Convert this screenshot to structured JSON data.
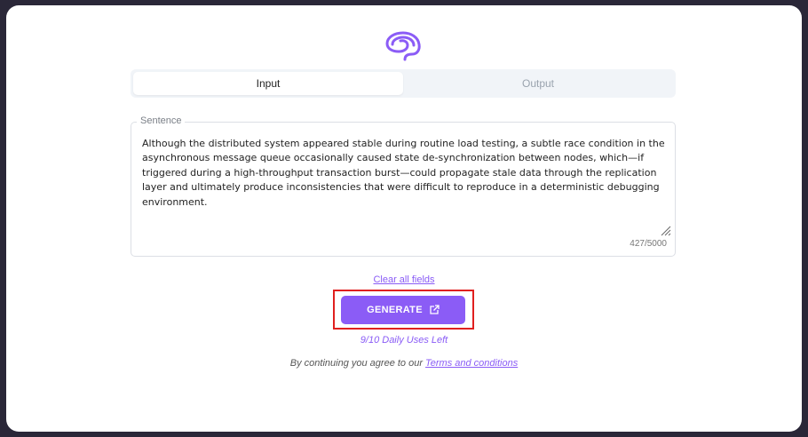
{
  "tabs": {
    "input_label": "Input",
    "output_label": "Output",
    "active": "Input"
  },
  "sentence_field": {
    "label": "Sentence",
    "value": "Although the distributed system appeared stable during routine load testing, a subtle race condition in the asynchronous message queue occasionally caused state de-synchronization between nodes, which—if triggered during a high-throughput transaction burst—could propagate stale data through the replication layer and ultimately produce inconsistencies that were difficult to reproduce in a deterministic debugging environment.",
    "counter": "427/5000"
  },
  "clear_link": "Clear all fields",
  "generate_button": {
    "label": "GENERATE",
    "icon": "external-link-icon"
  },
  "uses_left": "9/10 Daily Uses Left",
  "terms": {
    "prefix": "By continuing you agree to our ",
    "link": "Terms and conditions"
  },
  "colors": {
    "accent": "#8b5cf6",
    "highlight_box": "#e0201f",
    "backdrop": "#2a2738"
  }
}
